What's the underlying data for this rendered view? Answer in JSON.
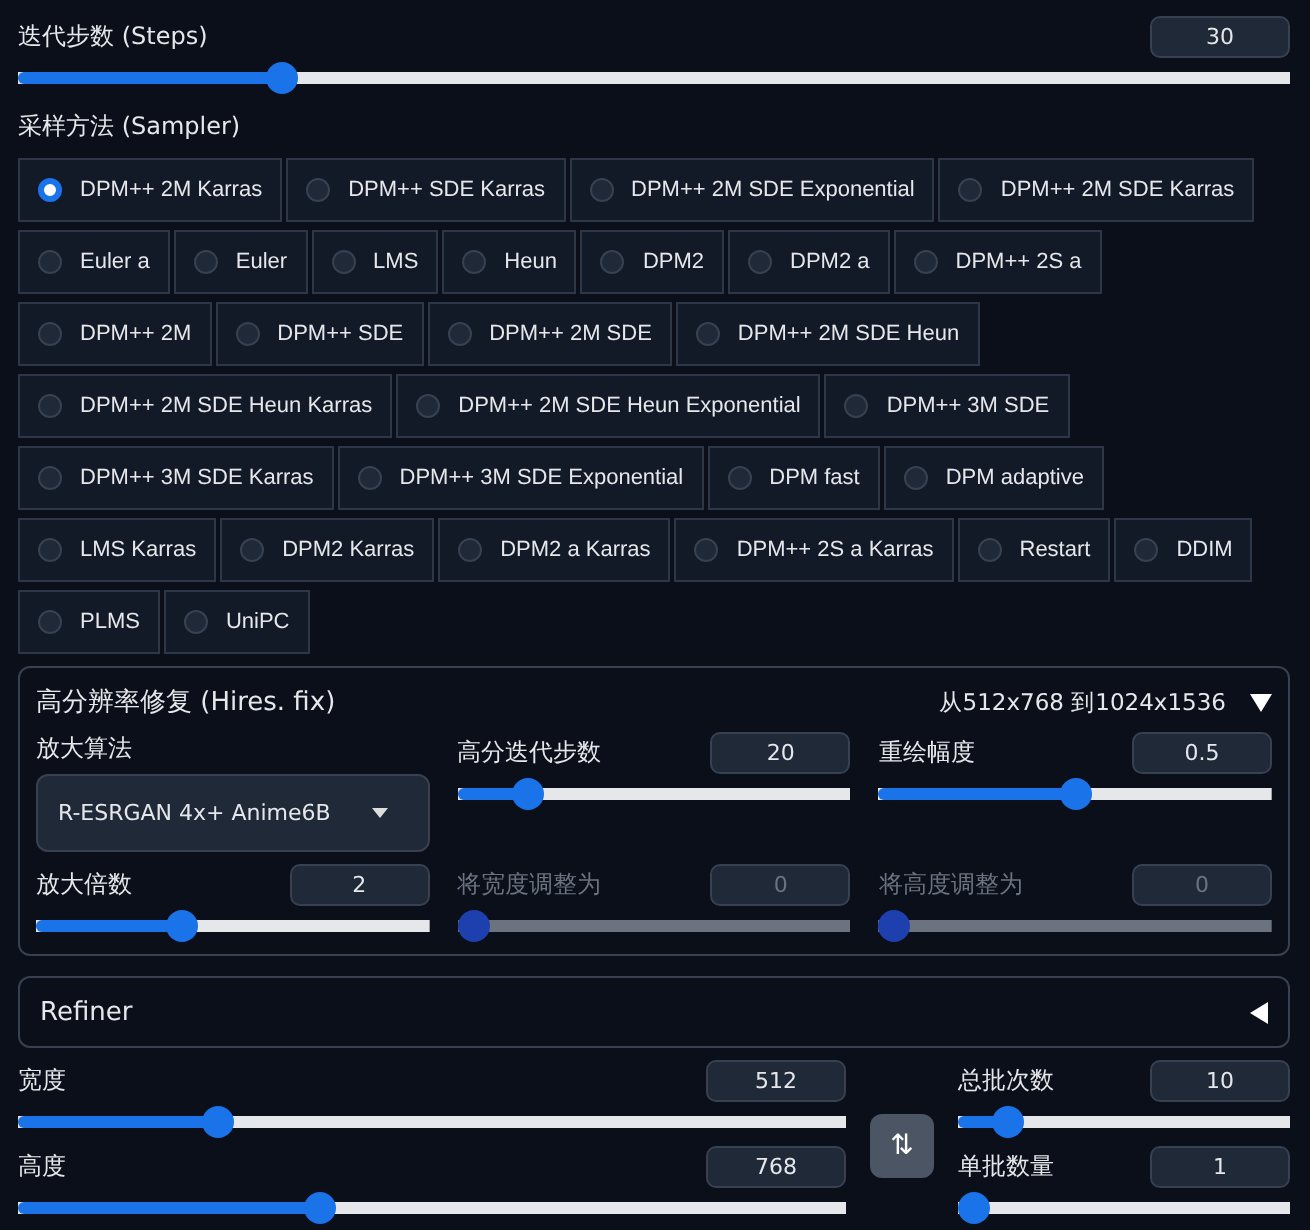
{
  "steps": {
    "label": "迭代步数 (Steps)",
    "value": "30",
    "level": 0.2
  },
  "sampler": {
    "label": "采样方法 (Sampler)",
    "options": [
      {
        "label": "DPM++ 2M Karras",
        "selected": true
      },
      {
        "label": "DPM++ SDE Karras",
        "selected": false
      },
      {
        "label": "DPM++ 2M SDE Exponential",
        "selected": false
      },
      {
        "label": "DPM++ 2M SDE Karras",
        "selected": false
      },
      {
        "label": "Euler a",
        "selected": false
      },
      {
        "label": "Euler",
        "selected": false
      },
      {
        "label": "LMS",
        "selected": false
      },
      {
        "label": "Heun",
        "selected": false
      },
      {
        "label": "DPM2",
        "selected": false
      },
      {
        "label": "DPM2 a",
        "selected": false
      },
      {
        "label": "DPM++ 2S a",
        "selected": false
      },
      {
        "label": "DPM++ 2M",
        "selected": false
      },
      {
        "label": "DPM++ SDE",
        "selected": false
      },
      {
        "label": "DPM++ 2M SDE",
        "selected": false
      },
      {
        "label": "DPM++ 2M SDE Heun",
        "selected": false
      },
      {
        "label": "DPM++ 2M SDE Heun Karras",
        "selected": false
      },
      {
        "label": "DPM++ 2M SDE Heun Exponential",
        "selected": false
      },
      {
        "label": "DPM++ 3M SDE",
        "selected": false
      },
      {
        "label": "DPM++ 3M SDE Karras",
        "selected": false
      },
      {
        "label": "DPM++ 3M SDE Exponential",
        "selected": false
      },
      {
        "label": "DPM fast",
        "selected": false
      },
      {
        "label": "DPM adaptive",
        "selected": false
      },
      {
        "label": "LMS Karras",
        "selected": false
      },
      {
        "label": "DPM2 Karras",
        "selected": false
      },
      {
        "label": "DPM2 a Karras",
        "selected": false
      },
      {
        "label": "DPM++ 2S a Karras",
        "selected": false
      },
      {
        "label": "Restart",
        "selected": false
      },
      {
        "label": "DDIM",
        "selected": false
      },
      {
        "label": "PLMS",
        "selected": false
      },
      {
        "label": "UniPC",
        "selected": false
      }
    ]
  },
  "hires_fix": {
    "title": "高分辨率修复 (Hires. fix)",
    "summary": "从512x768 到1024x1536",
    "expanded": true,
    "upscaler": {
      "label": "放大算法",
      "value": "R-ESRGAN 4x+ Anime6B"
    },
    "sliders": [
      {
        "label": "高分迭代步数",
        "value": "20",
        "level": 0.15,
        "disabled": false
      },
      {
        "label": "重绘幅度",
        "value": "0.5",
        "level": 0.5,
        "disabled": false
      },
      {
        "label": "放大倍数",
        "value": "2",
        "level": 0.36,
        "disabled": false
      },
      {
        "label": "将宽度调整为",
        "value": "0",
        "level": 0,
        "disabled": true
      },
      {
        "label": "将高度调整为",
        "value": "0",
        "level": 0,
        "disabled": true
      }
    ]
  },
  "refiner": {
    "title": "Refiner",
    "expanded": false
  },
  "size": [
    {
      "label": "宽度",
      "value": "512",
      "level": 0.23
    },
    {
      "label": "高度",
      "value": "768",
      "level": 0.36
    }
  ],
  "swap_button": "⇅",
  "batch": [
    {
      "label": "总批次数",
      "value": "10",
      "level": 0.11
    },
    {
      "label": "单批数量",
      "value": "1",
      "level": 0
    }
  ]
}
